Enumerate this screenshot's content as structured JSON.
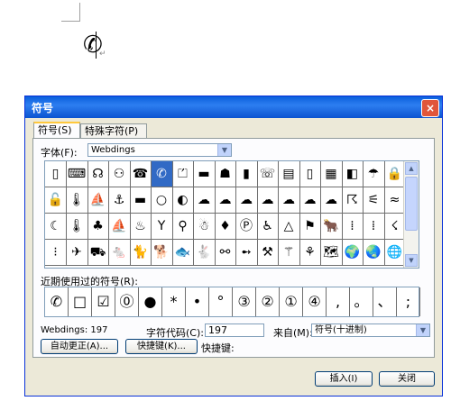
{
  "document": {
    "glyph": "✆"
  },
  "dialog": {
    "title": "符号",
    "close": "×",
    "tabs": [
      {
        "label": "符号(S)"
      },
      {
        "label": "特殊字符(P)"
      }
    ],
    "font": {
      "label": "字体(F):",
      "value": "Webdings",
      "arrow": "▼"
    },
    "grid": {
      "rows": [
        [
          "▯",
          "⌨",
          "☊",
          "⚇",
          "☎",
          "✆",
          "⏍",
          "▬",
          "☗",
          "▮",
          "☏",
          "▤",
          "▯",
          "▦",
          "◧",
          "☂",
          "🔒"
        ],
        [
          "🔓",
          "🌡",
          "⛵",
          "⚓",
          "▬",
          "○",
          "◐",
          "☁",
          "☁",
          "☁",
          "☁",
          "☁",
          "☁",
          "☁",
          "☈",
          "⚟",
          "≈"
        ],
        [
          "☾",
          "🌡",
          "♣",
          "⛵",
          "♨",
          "Y",
          "⚲",
          "☃",
          "♦",
          "Ⓟ",
          "♿",
          "△",
          "⚑",
          "🐂",
          "⁞",
          "⁞",
          "☇"
        ],
        [
          "⁝",
          "✈",
          "⛟",
          "🐁",
          "🐈",
          "🐕",
          "🐟",
          "🐇",
          "⚯",
          "➻",
          "⚒",
          "⚚",
          "⚘",
          "🗺",
          "🌍",
          "🌏",
          "🌐"
        ]
      ],
      "selected_row": 0,
      "selected_col": 5,
      "scroll_up": "▲",
      "scroll_down": "▼"
    },
    "recent": {
      "label": "近期使用过的符号(R):",
      "symbols": [
        "✆",
        "□",
        "☑",
        "⓪",
        "●",
        "*",
        "•",
        "°",
        "③",
        "②",
        "①",
        "④",
        ",",
        "。",
        "、",
        ";"
      ]
    },
    "char_info": "Webdings: 197",
    "code": {
      "label": "字符代码(C):",
      "value": "197"
    },
    "from": {
      "label": "来自(M):",
      "value": "符号(十进制)",
      "arrow": "▼"
    },
    "buttons": {
      "autocorrect": "自动更正(A)...",
      "shortcut_key": "快捷键(K)...",
      "shortcut_label": "快捷键:",
      "insert": "插入(I)",
      "close": "关闭"
    }
  }
}
